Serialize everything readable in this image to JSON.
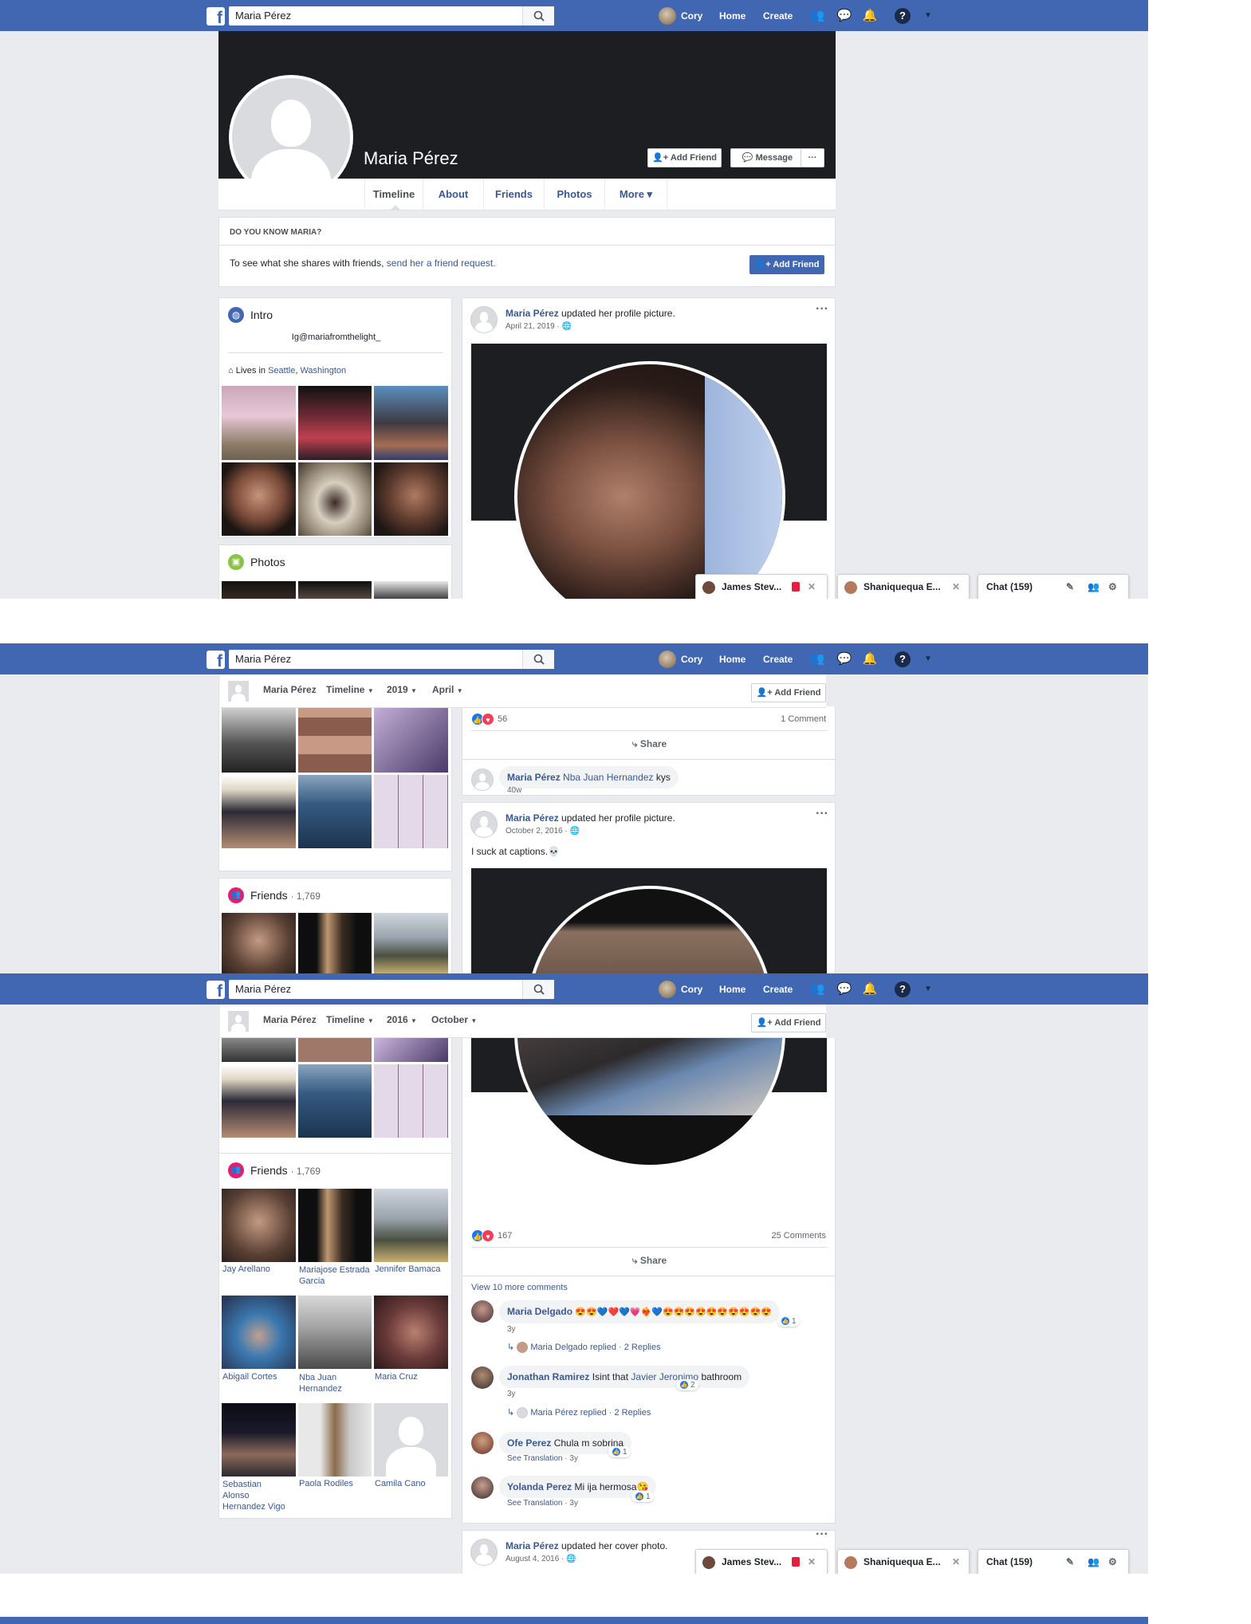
{
  "topbar": {
    "search_value": "Maria Pérez",
    "user_name": "Cory",
    "home": "Home",
    "create": "Create"
  },
  "profile": {
    "name": "Maria Pérez",
    "add_friend": "Add Friend",
    "message": "Message",
    "more_dots": "···",
    "tabs": [
      "Timeline",
      "About",
      "Friends",
      "Photos",
      "More ▾"
    ]
  },
  "know_box": {
    "heading": "DO YOU KNOW MARIA?",
    "text": "To see what she shares with friends,",
    "link": "send her a friend request.",
    "button": "Add Friend"
  },
  "intro": {
    "title": "Intro",
    "bio": "Ig@mariafromthelight_",
    "lives_prefix": "Lives in",
    "city": "Seattle",
    "state": "Washington"
  },
  "photos_section": {
    "title": "Photos"
  },
  "post1": {
    "author": "Maria Pérez",
    "action": "updated her profile picture.",
    "date": "April 21, 2019 ·",
    "dots": "···"
  },
  "chat": {
    "tab1": "James Stev...",
    "tab2": "Shaniquequa E...",
    "tab3": "Chat (159)"
  },
  "sticky2": {
    "name": "Maria Pérez",
    "timeline": "Timeline",
    "year": "2019",
    "month": "April",
    "add_friend": "Add Friend"
  },
  "sticky3": {
    "name": "Maria Pérez",
    "timeline": "Timeline",
    "year": "2016",
    "month": "October",
    "add_friend": "Add Friend"
  },
  "post1_footer": {
    "reaction_count": "56",
    "comments": "1 Comment",
    "share": "Share",
    "c_author": "Maria Pérez",
    "c_tag": "Nba Juan Hernandez",
    "c_text": "kys",
    "c_time": "40w"
  },
  "post2": {
    "author": "Maria Pérez",
    "action": "updated her profile picture.",
    "date": "October 2, 2016 ·",
    "caption": "I suck at captions.💀",
    "dots": "···",
    "reaction_count": "167",
    "comments": "25 Comments",
    "share": "Share",
    "view_more": "View 10 more comments"
  },
  "comments": [
    {
      "author": "Maria Delgado",
      "text": "😍😍💙❤️💙💗❤️‍🔥💙😍😍😍😍😍😍😍😍😍😍",
      "time": "3y",
      "likes": "1"
    },
    {
      "author": "Jonathan Ramirez",
      "text_a": "Isint that",
      "tag": "Javier Jeronimo",
      "text_b": "bathroom",
      "time": "3y",
      "likes": "2"
    },
    {
      "author": "Ofe Perez",
      "text": "Chula m sobrina",
      "translate": "See Translation",
      "time": "· 3y",
      "likes": "1"
    },
    {
      "author": "Yolanda Perez",
      "text": "Mi ija hermosa😘",
      "translate": "See Translation",
      "time": "· 3y",
      "likes": "1"
    }
  ],
  "replies": [
    {
      "who": "Maria Delgado replied",
      "count": "· 2 Replies"
    },
    {
      "who": "Maria Pérez replied",
      "count": "· 2 Replies"
    }
  ],
  "post3": {
    "author": "Maria Pérez",
    "action": "updated her cover photo.",
    "date": "August 4, 2016 ·",
    "dots": "···"
  },
  "friends_section": {
    "title": "Friends",
    "count": "· 1,769",
    "names": [
      "Jay Arellano",
      "Mariajose Estrada Garcia",
      "Jennifer Bamaca",
      "Abigail Cortes",
      "Nba Juan Hernandez",
      "Maria Cruz",
      "Sebastian Alonso Hernandez Vigo",
      "Paola Rodiles",
      "Camila Cano"
    ]
  },
  "colors": {
    "brand": "#4267b2",
    "page_bg": "#e9ebee",
    "link": "#385898"
  }
}
